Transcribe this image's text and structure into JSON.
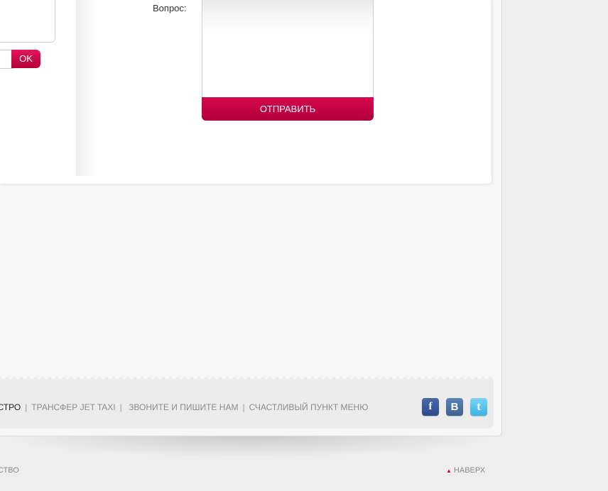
{
  "form": {
    "question_label": "Вопрос:",
    "question_value": "",
    "submit_label": "ОТПРАВИТЬ",
    "ok_label": "OK"
  },
  "footer": {
    "menu": [
      {
        "label": "БЫСТРО",
        "active": true
      },
      {
        "label": "ТРАНСФЕР JET TAXI",
        "active": false
      },
      {
        "label": "ЗВОНИТЕ И ПИШИТЕ НАМ",
        "active": false
      },
      {
        "label": "СЧАСТЛИВЫЙ ПУНКТ МЕНЮ",
        "active": false
      }
    ],
    "separator": "|",
    "social": [
      {
        "name": "facebook-icon",
        "glyph": "f",
        "color": "#3b5998"
      },
      {
        "name": "vkontakte-icon",
        "glyph": "B",
        "color": "#4c75a3"
      },
      {
        "name": "twitter-icon",
        "glyph": "t",
        "color": "#55c0ee"
      }
    ],
    "copyright_fragment": "СТВО",
    "to_top_label": "НАВЕРХ"
  },
  "colors": {
    "accent": "#c8003f",
    "page_bg": "#eeeeee",
    "panel_bg": "#ffffff"
  }
}
